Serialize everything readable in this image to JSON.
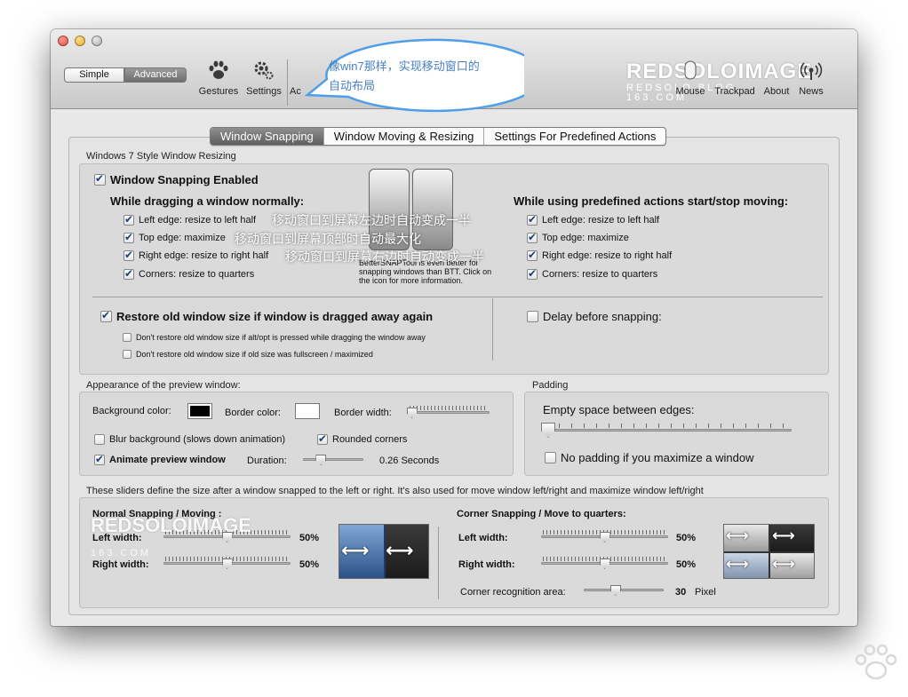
{
  "toolbar": {
    "mode_simple": "Simple",
    "mode_advanced": "Advanced",
    "items": {
      "gestures": {
        "label": "Gestures",
        "icon": "paw-icon"
      },
      "settings": {
        "label": "Settings",
        "icon": "gear-icon"
      },
      "actions": {
        "label": "Ac"
      },
      "mouse": {
        "label": "Mouse",
        "icon": "mouse-icon"
      },
      "trackpad": {
        "label": "Trackpad"
      },
      "about": {
        "label": "About"
      },
      "news": {
        "label": "News",
        "icon": "broadcast-icon"
      }
    },
    "watermark": {
      "line1": "REDSOLOIMAGE",
      "line2": "REDSOLO.BLOG.",
      "line3": "163.COM"
    },
    "callout_text": "像win7那样，实现移动窗口的自动布局"
  },
  "tabs": [
    {
      "label": "Window Snapping",
      "active": true
    },
    {
      "label": "Window Moving & Resizing",
      "active": false
    },
    {
      "label": "Settings For Predefined Actions",
      "active": false
    }
  ],
  "snapping": {
    "section_title": "Windows 7 Style Window Resizing",
    "enabled_label": "Window Snapping Enabled",
    "dragging_heading": "While dragging a window normally:",
    "dragging_options": [
      {
        "label": "Left edge: resize to left half",
        "checked": true,
        "annotation": "移动窗口到屏幕左边时自动变成一半"
      },
      {
        "label": "Top edge: maximize",
        "checked": true,
        "annotation": "移动窗口到屏幕顶部时自动最大化"
      },
      {
        "label": "Right edge: resize to right half",
        "checked": true,
        "annotation": "移动窗口到屏幕右边时自动变成一半"
      },
      {
        "label": "Corners: resize to quarters",
        "checked": true,
        "annotation": ""
      }
    ],
    "predefined_heading": "While using predefined actions start/stop moving:",
    "predefined_options": [
      {
        "label": "Left edge: resize to left half",
        "checked": true
      },
      {
        "label": "Top edge: maximize",
        "checked": true
      },
      {
        "label": "Right edge: resize to right half",
        "checked": true
      },
      {
        "label": "Corners: resize to quarters",
        "checked": true
      }
    ],
    "bettersnap_tip": "BetterSNAPTool is even better for snapping windows than BTT. Click on the icon for more information.",
    "restore_label": "Restore old window size if window is dragged away again",
    "restore_checked": true,
    "restore_sub": [
      {
        "label": "Don't restore old window size if alt/opt is pressed while dragging the window away",
        "checked": false
      },
      {
        "label": "Don't restore old window size if old size was fullscreen / maximized",
        "checked": false
      }
    ],
    "delay_label": "Delay before snapping:",
    "delay_checked": false
  },
  "appearance": {
    "section_title": "Appearance of the preview window:",
    "bg_color_label": "Background color:",
    "bg_color": "#000000",
    "border_color_label": "Border color:",
    "border_color": "#ffffff",
    "border_width_label": "Border width:",
    "border_width_level": 0.05,
    "blur_label": "Blur background (slows down animation)",
    "blur_checked": false,
    "rounded_label": "Rounded corners",
    "rounded_checked": true,
    "animate_label": "Animate preview window",
    "animate_checked": true,
    "duration_label": "Duration:",
    "duration_value": "0.26 Seconds",
    "duration_level": 0.3
  },
  "padding": {
    "section_title": "Padding",
    "empty_space_label": "Empty space between edges:",
    "empty_space_level": 0.0,
    "no_padding_label": "No padding if you maximize a window",
    "no_padding_checked": false
  },
  "sizes": {
    "description": "These sliders define the size after a window snapped to the left or right. It's also used for move window left/right and maximize window left/right",
    "normal_heading": "Normal Snapping / Moving :",
    "normal_left_label": "Left width:",
    "normal_left_value": "50%",
    "normal_left_level": 0.5,
    "normal_right_label": "Right width:",
    "normal_right_value": "50%",
    "normal_right_level": 0.5,
    "corner_heading": "Corner Snapping / Move to quarters:",
    "corner_left_label": "Left width:",
    "corner_left_value": "50%",
    "corner_left_level": 0.5,
    "corner_right_label": "Right width:",
    "corner_right_value": "50%",
    "corner_right_level": 0.5,
    "recognition_label": "Corner recognition area:",
    "recognition_value": "30",
    "recognition_unit": "Pixel",
    "recognition_level": 0.4
  },
  "colors": {
    "accent": "#4f9ee8",
    "callout_fill": "#ffffff",
    "callout_border": "#4f9ee8",
    "annotation_text": "#ffffff"
  }
}
